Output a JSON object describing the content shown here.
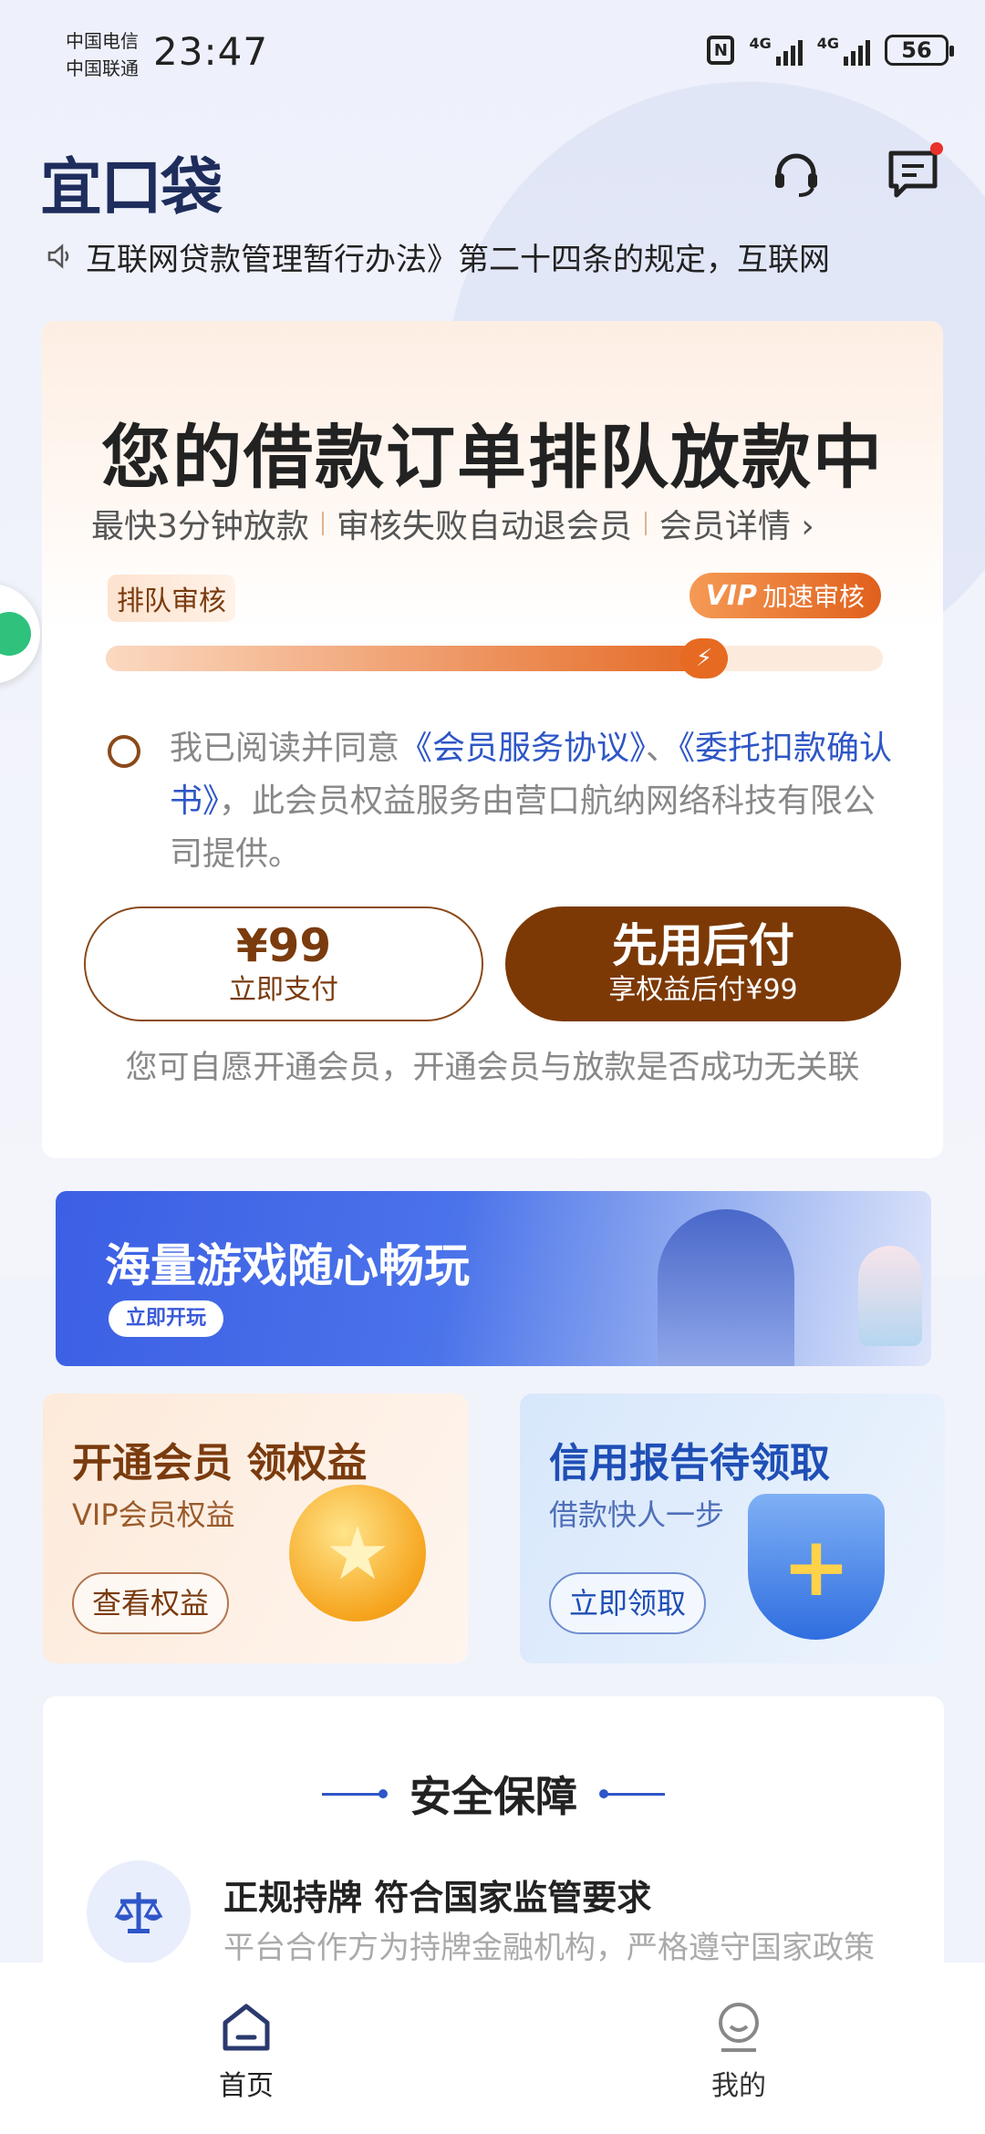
{
  "status_bar": {
    "carrier_1": "中国电信",
    "carrier_2": "中国联通",
    "time": "23:47",
    "network_1": "4G",
    "network_2": "4G",
    "nfc": "N",
    "battery": "56"
  },
  "header": {
    "logo": "宜口袋",
    "support_icon": "headset-icon",
    "message_icon": "message-icon"
  },
  "notice": {
    "icon": "speaker-icon",
    "text": "互联网贷款管理暂行办法》第二十四条的规定，互联网"
  },
  "main_card": {
    "title": "您的借款订单排队放款中",
    "sub_1": "最快3分钟放款",
    "sub_2": "审核失败自动退会员",
    "sub_3": "会员详情",
    "progress_label": "排队审核",
    "vip_badge_vip": "VIP",
    "vip_badge_text": "加速审核",
    "progress": 0.8,
    "agreement_prefix": "我已阅读并同意",
    "agreement_link_1": "《会员服务协议》",
    "agreement_sep": "、",
    "agreement_link_2": "《委托扣款确认书》",
    "agreement_suffix": "，此会员权益服务由营口航纳网络科技有限公司提供。",
    "pay_price": "¥99",
    "pay_label": "立即支付",
    "later_title": "先用后付",
    "later_label": "享权益后付¥99",
    "disclaimer": "您可自愿开通会员，开通会员与放款是否成功无关联"
  },
  "banner": {
    "title": "海量游戏随心畅玩",
    "button": "立即开玩"
  },
  "card_member": {
    "title": "开通会员 领权益",
    "subtitle": "VIP会员权益",
    "button": "查看权益"
  },
  "card_credit": {
    "title": "信用报告待领取",
    "subtitle": "借款快人一步",
    "button": "立即领取"
  },
  "security": {
    "title": "安全保障",
    "item_title": "正规持牌 符合国家监管要求",
    "item_desc": "平台合作方为持牌金融机构，严格遵守国家政策"
  },
  "tabbar": {
    "home": "首页",
    "mine": "我的"
  },
  "colors": {
    "brand_brown": "#7c3905",
    "link_blue": "#2e56c6",
    "accent_orange": "#e4661f"
  }
}
